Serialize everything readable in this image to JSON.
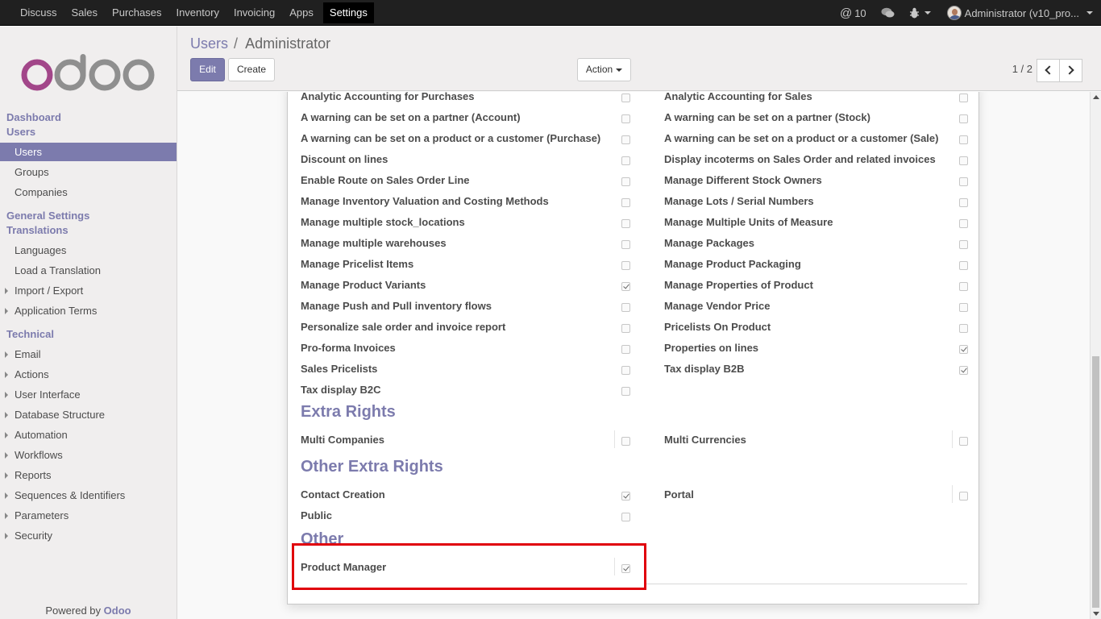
{
  "topbar": {
    "menu": [
      "Discuss",
      "Sales",
      "Purchases",
      "Inventory",
      "Invoicing",
      "Apps",
      "Settings"
    ],
    "active_menu": "Settings",
    "messages_count": "10",
    "user_label": "Administrator (v10_pro..."
  },
  "sidebar": {
    "sections": {
      "dashboard": "Dashboard",
      "users": "Users",
      "general_settings": "General Settings",
      "translations": "Translations",
      "technical": "Technical"
    },
    "users_items": [
      "Users",
      "Groups",
      "Companies"
    ],
    "translation_items": [
      "Languages",
      "Load a Translation",
      "Import / Export",
      "Application Terms"
    ],
    "technical_items": [
      "Email",
      "Actions",
      "User Interface",
      "Database Structure",
      "Automation",
      "Workflows",
      "Reports",
      "Sequences & Identifiers",
      "Parameters",
      "Security"
    ],
    "powered_by": "Powered by",
    "powered_brand": "Odoo"
  },
  "breadcrumb": {
    "parent": "Users",
    "separator": "/",
    "current": "Administrator"
  },
  "buttons": {
    "edit": "Edit",
    "create": "Create",
    "action": "Action"
  },
  "pager": "1 / 2",
  "rights_rows": [
    {
      "left": "Analytic Accounting for Purchases",
      "left_checked": false,
      "right": "Analytic Accounting for Sales",
      "right_checked": false
    },
    {
      "left": "A warning can be set on a partner (Account)",
      "left_checked": false,
      "right": "A warning can be set on a partner (Stock)",
      "right_checked": false
    },
    {
      "left": "A warning can be set on a product or a customer (Purchase)",
      "left_checked": false,
      "right": "A warning can be set on a product or a customer (Sale)",
      "right_checked": false
    },
    {
      "left": "Discount on lines",
      "left_checked": false,
      "right": "Display incoterms on Sales Order and related invoices",
      "right_checked": false
    },
    {
      "left": "Enable Route on Sales Order Line",
      "left_checked": false,
      "right": "Manage Different Stock Owners",
      "right_checked": false
    },
    {
      "left": "Manage Inventory Valuation and Costing Methods",
      "left_checked": false,
      "right": "Manage Lots / Serial Numbers",
      "right_checked": false
    },
    {
      "left": "Manage multiple stock_locations",
      "left_checked": false,
      "right": "Manage Multiple Units of Measure",
      "right_checked": false
    },
    {
      "left": "Manage multiple warehouses",
      "left_checked": false,
      "right": "Manage Packages",
      "right_checked": false
    },
    {
      "left": "Manage Pricelist Items",
      "left_checked": false,
      "right": "Manage Product Packaging",
      "right_checked": false
    },
    {
      "left": "Manage Product Variants",
      "left_checked": true,
      "right": "Manage Properties of Product",
      "right_checked": false
    },
    {
      "left": "Manage Push and Pull inventory flows",
      "left_checked": false,
      "right": "Manage Vendor Price",
      "right_checked": false
    },
    {
      "left": "Personalize sale order and invoice report",
      "left_checked": false,
      "right": "Pricelists On Product",
      "right_checked": false
    },
    {
      "left": "Pro-forma Invoices",
      "left_checked": false,
      "right": "Properties on lines",
      "right_checked": true
    },
    {
      "left": "Sales Pricelists",
      "left_checked": false,
      "right": "Tax display B2B",
      "right_checked": true
    },
    {
      "left": "Tax display B2C",
      "left_checked": false,
      "right": "",
      "right_checked": null
    }
  ],
  "extra_rights": {
    "title": "Extra Rights",
    "left": "Multi Companies",
    "left_checked": false,
    "right": "Multi Currencies",
    "right_checked": false
  },
  "other_extra_rights": {
    "title": "Other Extra Rights",
    "rows": [
      {
        "left": "Contact Creation",
        "left_checked": true,
        "right": "Portal",
        "right_checked": false
      },
      {
        "left": "Public",
        "left_checked": false,
        "right": "",
        "right_checked": null
      }
    ]
  },
  "other": {
    "title": "Other",
    "label": "Product Manager",
    "checked": true
  },
  "colors": {
    "brand": "#7c7bad",
    "highlight": "#e0000b",
    "topbar": "#202020"
  }
}
